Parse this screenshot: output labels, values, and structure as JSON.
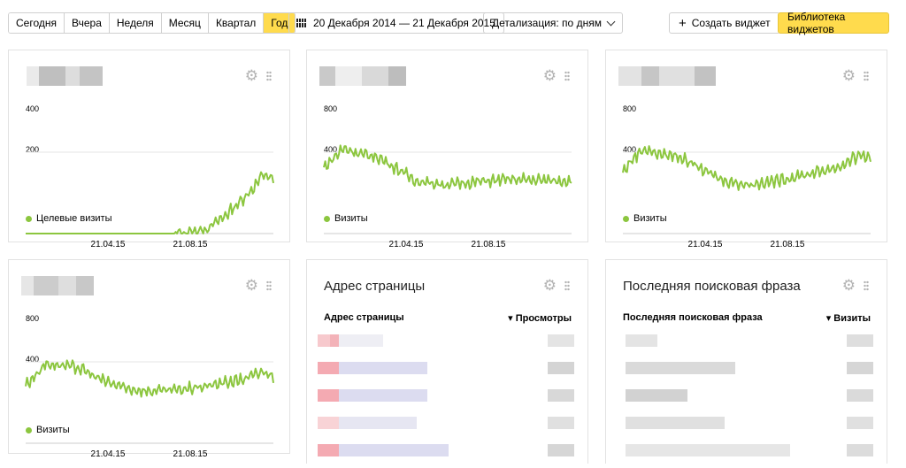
{
  "toolbar": {
    "periods": [
      {
        "label": "Сегодня",
        "active": false
      },
      {
        "label": "Вчера",
        "active": false
      },
      {
        "label": "Неделя",
        "active": false
      },
      {
        "label": "Месяц",
        "active": false
      },
      {
        "label": "Квартал",
        "active": false
      },
      {
        "label": "Год",
        "active": true
      }
    ],
    "date_range": "20 Декабря 2014 — 21 Декабря 2015",
    "detail_select": "Детализация: по дням",
    "create_widget": "Создать виджет",
    "widget_library": "Библиотека виджетов",
    "accent_color": "#ffdb4d"
  },
  "widgets": {
    "w1": {
      "legend": "Целевые визиты",
      "x_ticks": [
        "21.04.15",
        "21.08.15"
      ],
      "y_ticks": [
        "400",
        "200"
      ]
    },
    "w2": {
      "legend": "Визиты",
      "x_ticks": [
        "21.04.15",
        "21.08.15"
      ],
      "y_ticks": [
        "800",
        "400"
      ]
    },
    "w3": {
      "legend": "Визиты",
      "x_ticks": [
        "21.04.15",
        "21.08.15"
      ],
      "y_ticks": [
        "800",
        "400"
      ]
    },
    "w4": {
      "legend": "Визиты",
      "x_ticks": [
        "21.04.15",
        "21.08.15"
      ],
      "y_ticks": [
        "800",
        "400"
      ]
    },
    "w5": {
      "title": "Адрес страницы",
      "col_left": "Адрес страницы",
      "col_right": "▾ Просмотры"
    },
    "w6": {
      "title": "Последняя поисковая фраза",
      "col_left": "Последняя поисковая фраза",
      "col_right": "▾ Визиты"
    }
  },
  "icons": {
    "settings": "gear-icon",
    "drag": "drag-handle-icon",
    "calendar": "calendar-icon"
  },
  "series_color": "#8cc63f",
  "chart_data": [
    {
      "type": "line",
      "series": [
        {
          "name": "Целевые визиты"
        }
      ],
      "ylim": [
        0,
        400
      ],
      "ticks_y": [
        400,
        200
      ],
      "shape": [
        [
          0,
          0
        ],
        [
          0.2,
          0
        ],
        [
          0.4,
          0
        ],
        [
          0.6,
          0
        ],
        [
          0.68,
          2
        ],
        [
          0.74,
          20
        ],
        [
          0.8,
          55
        ],
        [
          0.86,
          100
        ],
        [
          0.92,
          150
        ],
        [
          0.96,
          195
        ],
        [
          1,
          175
        ]
      ]
    },
    {
      "type": "line",
      "series": [
        {
          "name": "Визиты"
        }
      ],
      "ylim": [
        0,
        800
      ],
      "ticks_y": [
        800,
        400
      ],
      "shape": [
        [
          0,
          430
        ],
        [
          0.03,
          480
        ],
        [
          0.08,
          560
        ],
        [
          0.15,
          520
        ],
        [
          0.22,
          500
        ],
        [
          0.3,
          420
        ],
        [
          0.38,
          340
        ],
        [
          0.5,
          320
        ],
        [
          0.62,
          340
        ],
        [
          0.75,
          355
        ],
        [
          0.88,
          350
        ],
        [
          1,
          345
        ]
      ]
    },
    {
      "type": "line",
      "series": [
        {
          "name": "Визиты"
        }
      ],
      "ylim": [
        0,
        800
      ],
      "ticks_y": [
        800,
        400
      ],
      "shape": [
        [
          0,
          400
        ],
        [
          0.03,
          470
        ],
        [
          0.08,
          555
        ],
        [
          0.15,
          520
        ],
        [
          0.22,
          510
        ],
        [
          0.3,
          440
        ],
        [
          0.4,
          350
        ],
        [
          0.5,
          320
        ],
        [
          0.62,
          345
        ],
        [
          0.75,
          390
        ],
        [
          0.88,
          440
        ],
        [
          0.96,
          520
        ],
        [
          1,
          480
        ]
      ]
    },
    {
      "type": "line",
      "series": [
        {
          "name": "Визиты"
        }
      ],
      "ylim": [
        0,
        800
      ],
      "ticks_y": [
        800,
        400
      ],
      "shape": [
        [
          0,
          380
        ],
        [
          0.03,
          430
        ],
        [
          0.08,
          520
        ],
        [
          0.15,
          510
        ],
        [
          0.22,
          490
        ],
        [
          0.3,
          420
        ],
        [
          0.4,
          360
        ],
        [
          0.5,
          340
        ],
        [
          0.62,
          350
        ],
        [
          0.75,
          380
        ],
        [
          0.88,
          420
        ],
        [
          0.96,
          470
        ],
        [
          1,
          440
        ]
      ]
    }
  ]
}
